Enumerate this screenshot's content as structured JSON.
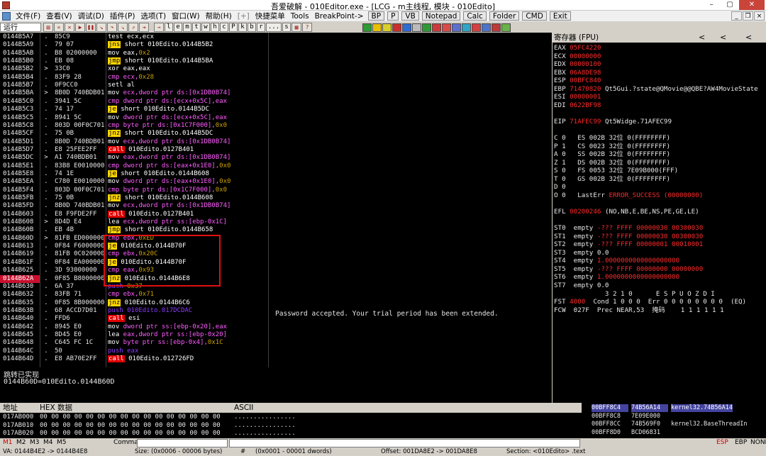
{
  "window": {
    "title": "吾爱破解 - 010Editor.exe - [LCG - m主线程, 模块 - 010Edito]",
    "min": "–",
    "max": "▢",
    "close": "✕"
  },
  "menu": {
    "items": [
      "文件(F)",
      "查看(V)",
      "调试(D)",
      "插件(P)",
      "选项(T)",
      "窗口(W)",
      "帮助(H)",
      "[+]",
      "快捷菜单",
      "Tools",
      "BreakPoint->"
    ],
    "boxed": [
      "BP",
      "P",
      "VB",
      "Notepad",
      "Calc",
      "Folder",
      "CMD",
      "Exit"
    ]
  },
  "toolbar": {
    "status": "运行",
    "letters": [
      "l",
      "e",
      "m",
      "t",
      "w",
      "h",
      "c",
      "P",
      "k",
      "b",
      "r",
      "...",
      "s"
    ]
  },
  "cpu_rows": [
    {
      "a": "0144B5A7",
      "m": ".",
      "h": "85C9",
      "o": "test",
      "r": " ecx,ecx",
      "c": "op-test"
    },
    {
      "a": "0144B5A9",
      "m": ".",
      "h": "79 07",
      "o": "jns",
      "r": " short 010Edito.0144B5B2",
      "c": "op-jcc"
    },
    {
      "a": "0144B5AB",
      "m": ".",
      "h": "B8 02000000",
      "o": "mov",
      "r": " eax,",
      "n": "0x2",
      "c": "op-test"
    },
    {
      "a": "0144B5B0",
      "m": ".",
      "h": "EB 08",
      "o": "jmp",
      "r": " short 010Edito.0144B5BA",
      "c": "op-jmp"
    },
    {
      "a": "0144B5B2",
      "m": ">",
      "h": "33C0",
      "o": "xor",
      "r": " eax,eax",
      "c": "op-test"
    },
    {
      "a": "0144B5B4",
      "m": ".",
      "h": "83F9 28",
      "o": "cmp",
      "r": " ecx,",
      "n": "0x28",
      "c": "op-cmp"
    },
    {
      "a": "0144B5B7",
      "m": ".",
      "h": "0F9CC0",
      "o": "setl",
      "r": " al",
      "c": "op-test"
    },
    {
      "a": "0144B5BA",
      "m": ">",
      "h": "8B0D 740BDB01",
      "o": "mov",
      "r": " ecx,dword ptr ds:[0x1DB0B74]",
      "c": "op-test",
      "rc": "num"
    },
    {
      "a": "0144B5C0",
      "m": ".",
      "h": "3941 5C",
      "o": "cmp",
      "r": " dword ptr ds:[ecx+0x5C],eax",
      "c": "op-cmp"
    },
    {
      "a": "0144B5C3",
      "m": ".",
      "h": "74 17",
      "o": "je",
      "r": " short 010Edito.0144B5DC",
      "c": "op-jcc"
    },
    {
      "a": "0144B5C5",
      "m": ".",
      "h": "8941 5C",
      "o": "mov",
      "r": " dword ptr ds:[ecx+0x5C],eax",
      "c": "op-test",
      "rc": "op-cmp"
    },
    {
      "a": "0144B5C8",
      "m": ".",
      "h": "803D 00F0C701",
      "o": "cmp",
      "r": " byte ptr ds:[0x1C7F000],",
      "n": "0x0",
      "c": "op-cmp"
    },
    {
      "a": "0144B5CF",
      "m": ".",
      "h": "75 0B",
      "o": "jnz",
      "r": " short 010Edito.0144B5DC",
      "c": "op-jcc"
    },
    {
      "a": "0144B5D1",
      "m": ".",
      "h": "8B0D 740BDB01",
      "o": "mov",
      "r": " ecx,dword ptr ds:[0x1DB0B74]",
      "c": "op-test",
      "rc": "num"
    },
    {
      "a": "0144B5D7",
      "m": ".",
      "h": "E8 25FEE2FF",
      "o": "call",
      "r": " 010Edito.0127B401",
      "c": "op-call"
    },
    {
      "a": "0144B5DC",
      "m": ">",
      "h": "A1 740BDB01",
      "o": "mov",
      "r": " eax,dword ptr ds:[0x1DB0B74]",
      "c": "op-test",
      "rc": "op-cmp"
    },
    {
      "a": "0144B5E1",
      "m": ".",
      "h": "83B8 E0010000",
      "o": "cmp",
      "r": " dword ptr ds:[eax+0x1E0],",
      "n": "0x0",
      "c": "op-cmp"
    },
    {
      "a": "0144B5E8",
      "m": ".",
      "h": "74 1E",
      "o": "je",
      "r": " short 010Edito.0144B608",
      "c": "op-jcc"
    },
    {
      "a": "0144B5EA",
      "m": ".",
      "h": "C780 E0010000",
      "o": "mov",
      "r": " dword ptr ds:[eax+0x1E0],",
      "n": "0x0",
      "c": "op-test",
      "rc": "op-cmp"
    },
    {
      "a": "0144B5F4",
      "m": ".",
      "h": "803D 00F0C701",
      "o": "cmp",
      "r": " byte ptr ds:[0x1C7F000],",
      "n": "0x0",
      "c": "op-cmp"
    },
    {
      "a": "0144B5FB",
      "m": ".",
      "h": "75 0B",
      "o": "jnz",
      "r": " short 010Edito.0144B608",
      "c": "op-jcc"
    },
    {
      "a": "0144B5FD",
      "m": ".",
      "h": "8B0D 740BDB01",
      "o": "mov",
      "r": " ecx,dword ptr ds:[0x1DB0B74]",
      "c": "op-test",
      "rc": "num"
    },
    {
      "a": "0144B603",
      "m": ".",
      "h": "E8 F9FDE2FF",
      "o": "call",
      "r": " 010Edito.0127B401",
      "c": "op-call"
    },
    {
      "a": "0144B608",
      "m": ">",
      "h": "8D4D E4",
      "o": "lea",
      "r": " ecx,dword ptr ss:[ebp-0x1C]",
      "c": "op-test",
      "rc": "num"
    },
    {
      "a": "0144B60B",
      "m": ".",
      "h": "EB 4B",
      "o": "jmp",
      "r": " short 010Edito.0144B658",
      "c": "op-jmp"
    },
    {
      "a": "0144B60D",
      "m": ">",
      "h": "81FB ED000000",
      "o": "cmp",
      "r": " ebx,",
      "n": "0xED",
      "c": "op-cmp"
    },
    {
      "a": "0144B613",
      "m": ".",
      "h": "0F84 F6000000",
      "o": "je",
      "r": " 010Edito.0144B70F",
      "c": "op-jcc"
    },
    {
      "a": "0144B619",
      "m": ".",
      "h": "81FB 0C020000",
      "o": "cmp",
      "r": " ebx,",
      "n": "0x20C",
      "c": "op-cmp"
    },
    {
      "a": "0144B61F",
      "m": ".",
      "h": "0F84 EA000000",
      "o": "je",
      "r": " 010Edito.0144B70F",
      "c": "op-jcc"
    },
    {
      "a": "0144B625",
      "m": ".",
      "h": "3D 93000000",
      "o": "cmp",
      "r": " eax,",
      "n": "0x93",
      "c": "op-cmp"
    },
    {
      "a": "0144B62A",
      "m": ".",
      "h": "0F85 B8000000",
      "o": "jnz",
      "r": " 010Edito.0144B6E8",
      "c": "op-jcc",
      "sel": true
    },
    {
      "a": "0144B630",
      "m": ".",
      "h": "6A 37",
      "o": "push",
      "r": " ",
      "n": "0x37",
      "c": "op-push"
    },
    {
      "a": "0144B632",
      "m": ".",
      "h": "83FB 71",
      "o": "cmp",
      "r": " ebx,",
      "n": "0x71",
      "c": "op-cmp"
    },
    {
      "a": "0144B635",
      "m": ".",
      "h": "0F85 8B000000",
      "o": "jnz",
      "r": " 010Edito.0144B6C6",
      "c": "op-jcc"
    },
    {
      "a": "0144B63B",
      "m": ".",
      "h": "68 ACCD7D01",
      "o": "push",
      "r": " 010Edito.017DCDAC",
      "c": "op-push"
    },
    {
      "a": "0144B640",
      "m": ".",
      "h": "FFD6",
      "o": "call",
      "r": " esi",
      "c": "op-call"
    },
    {
      "a": "0144B642",
      "m": ".",
      "h": "8945 E0",
      "o": "mov",
      "r": " dword ptr ss:[ebp-0x20],eax",
      "c": "op-test",
      "rc": "op-cmp"
    },
    {
      "a": "0144B645",
      "m": ".",
      "h": "8D45 E0",
      "o": "lea",
      "r": " eax,dword ptr ss:[ebp-0x20]",
      "c": "op-test",
      "rc": "num"
    },
    {
      "a": "0144B648",
      "m": ".",
      "h": "C645 FC 1C",
      "o": "mov",
      "r": " byte ptr ss:[ebp-0x4],",
      "n": "0x1C",
      "c": "op-test",
      "rc": "op-cmp"
    },
    {
      "a": "0144B64C",
      "m": ".",
      "h": "50",
      "o": "push",
      "r": " eax",
      "c": "op-push"
    },
    {
      "a": "0144B64D",
      "m": ".",
      "h": "E8 AB70E2FF",
      "o": "call",
      "r": " 010Edito.012726FD",
      "c": "op-call"
    }
  ],
  "message": "Password accepted. Your trial period has been extended.",
  "info": {
    "line1": "跳转已实现",
    "line2": "0144B60D=010Edito.0144B60D"
  },
  "regs": {
    "title": "寄存器 (FPU)",
    "lines": [
      {
        "k": "EAX",
        "v": "05FC4220"
      },
      {
        "k": "ECX",
        "v": "00000000"
      },
      {
        "k": "EDX",
        "v": "00000100"
      },
      {
        "k": "EBX",
        "v": "06A8DE98"
      },
      {
        "k": "ESP",
        "v": "00BFC840"
      },
      {
        "k": "EBP",
        "v": "71470820",
        "x": " Qt5Gui.?state@QMovie@@QBE?AW4MovieState"
      },
      {
        "k": "ESI",
        "v": "00000001"
      },
      {
        "k": "EDI",
        "v": "0622BF98"
      },
      {
        "k": "",
        "v": ""
      },
      {
        "k": "EIP",
        "v": "71AFEC99",
        "x": " Qt5Widge.71AFEC99"
      },
      {
        "k": "",
        "v": ""
      },
      {
        "k": "C 0",
        "v": "",
        "x": "  ES 002B 32位 0(FFFFFFFF)"
      },
      {
        "k": "P 1",
        "v": "",
        "x": "  CS 0023 32位 0(FFFFFFFF)"
      },
      {
        "k": "A 0",
        "v": "",
        "x": "  SS 002B 32位 0(FFFFFFFF)"
      },
      {
        "k": "Z 1",
        "v": "",
        "x": "  DS 002B 32位 0(FFFFFFFF)"
      },
      {
        "k": "S 0",
        "v": "",
        "x": "  FS 0053 32位 7E09B000(FFF)"
      },
      {
        "k": "T 0",
        "v": "",
        "x": "  GS 002B 32位 0(FFFFFFFF)"
      },
      {
        "k": "D 0",
        "v": "",
        "x": ""
      },
      {
        "k": "O 0",
        "v": "",
        "x": "  LastErr ",
        "e": "ERROR_SUCCESS (00000000)"
      },
      {
        "k": "",
        "v": ""
      },
      {
        "k": "EFL",
        "v": "00200246",
        "x": " (NO,NB,E,BE,NS,PE,GE,LE)"
      },
      {
        "k": "",
        "v": ""
      },
      {
        "k": "ST0",
        "x": " empty ",
        "e": "-??? FFFF 00000030 00300030"
      },
      {
        "k": "ST1",
        "x": " empty ",
        "e": "-??? FFFF 00000030 00300030"
      },
      {
        "k": "ST2",
        "x": " empty ",
        "e": "-??? FFFF 00000001 00010001"
      },
      {
        "k": "ST3",
        "x": " empty 0.0",
        "e": ""
      },
      {
        "k": "ST4",
        "x": " empty ",
        "e": "1.0000000000000000000"
      },
      {
        "k": "ST5",
        "x": " empty ",
        "e": "-??? FFFF 00000000 00000000"
      },
      {
        "k": "ST6",
        "x": " empty ",
        "e": "1.0000000000000000000"
      },
      {
        "k": "ST7",
        "x": " empty 0.0",
        "e": ""
      },
      {
        "k": "",
        "x": "             3 2 1 0      E S P U O Z D I"
      },
      {
        "k": "FST",
        "v": "4000",
        "x": "  Cond 1 0 0 0  Err 0 0 0 0 0 0 0 0  (EQ)"
      },
      {
        "k": "FCW",
        "x": " 027F  Prec NEAR,53  掩码    1 1 1 1 1 1"
      }
    ]
  },
  "dump": {
    "h_addr": "地址",
    "h_hex": "HEX 数据",
    "h_ascii": "ASCII",
    "rows": [
      {
        "a": "017AB000",
        "h": "00 00 00 00 00 00 00 00 00 00 00 00 00 00 00 00",
        "c": "................"
      },
      {
        "a": "017AB010",
        "h": "00 00 00 00 00 00 00 00 00 00 00 00 00 00 00 00",
        "c": "................"
      },
      {
        "a": "017AB020",
        "h": "00 00 00 00 00 00 00 00 00 00 00 00 00 00 00 00",
        "c": "................"
      }
    ]
  },
  "stack": [
    {
      "a": "00BFF8C4",
      "v": "74B56A14",
      "c": "kernel32.74B56A14",
      "sel": true
    },
    {
      "a": "00BFF8C8",
      "v": "7E09E000",
      "c": ""
    },
    {
      "a": "00BFF8CC",
      "v": "74B569F0",
      "c": "kernel32.BaseThreadIn"
    },
    {
      "a": "00BFF8D0",
      "v": "BCD06831",
      "c": ""
    }
  ],
  "cmd": {
    "m": [
      "M1",
      "M2",
      "M3",
      "M4",
      "M5"
    ],
    "label": "Command:",
    "esp": "ESP",
    "ebp": "EBP",
    "none": "NONE"
  },
  "status": {
    "va": "VA: 0144B4E2 -> 0144B4E8",
    "size": "Size: (0x0006 - 00006 bytes)",
    "hash": "#",
    "dw": "(0x0001 - 00001 dwords)",
    "off": "Offset: 001DA8E2 -> 001DA8E8",
    "sec": "Section: <010Edito> .text"
  }
}
